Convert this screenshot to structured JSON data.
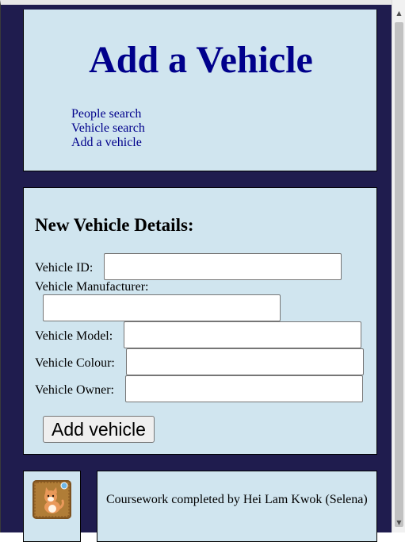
{
  "header": {
    "title": "Add a Vehicle",
    "nav": [
      {
        "label": "People search"
      },
      {
        "label": "Vehicle search"
      },
      {
        "label": "Add a vehicle"
      }
    ]
  },
  "form": {
    "heading": "New Vehicle Details:",
    "fields": [
      {
        "label": "Vehicle ID:",
        "value": ""
      },
      {
        "label": "Vehicle Manufacturer:",
        "value": ""
      },
      {
        "label": "Vehicle Model:",
        "value": ""
      },
      {
        "label": "Vehicle Colour:",
        "value": ""
      },
      {
        "label": "Vehicle Owner:",
        "value": ""
      }
    ],
    "submit_label": "Add vehicle"
  },
  "footer": {
    "text": "Coursework completed by Hei Lam Kwok (Selena)",
    "logo_icon": "cat-icon"
  },
  "scrollbar": {
    "up_icon": "scroll-up-arrow-icon",
    "down_icon": "scroll-down-arrow-icon"
  },
  "colors": {
    "page_background": "#1f1c4e",
    "panel_background": "#d0e5ef",
    "title_color": "#00008b",
    "link_color": "#00008b"
  }
}
